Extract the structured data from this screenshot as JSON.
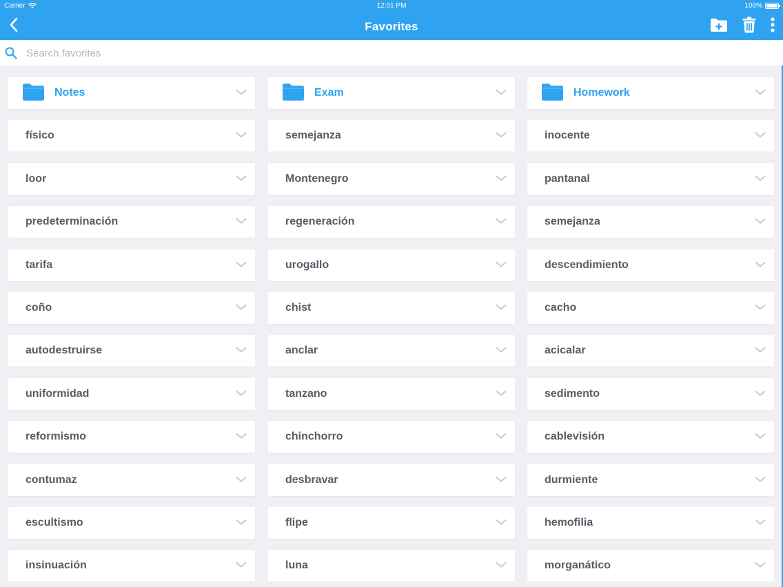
{
  "status_bar": {
    "carrier": "Carrier",
    "time": "12:01 PM",
    "battery": "100%",
    "battery_level": 1.0
  },
  "nav": {
    "title": "Favorites",
    "back_icon": "chevron-left-icon",
    "actions": [
      "add-folder-icon",
      "trash-icon",
      "more-vertical-icon"
    ]
  },
  "search": {
    "placeholder": "Search favorites",
    "value": ""
  },
  "colors": {
    "accent": "#2fa3f0",
    "background": "#efeff4",
    "word_text": "#555e66",
    "chevron": "#c9cfd5"
  },
  "columns": [
    {
      "folder": "Notes",
      "words": [
        "físico",
        "loor",
        "predeterminación",
        "tarifa",
        "coño",
        "autodestruirse",
        "uniformidad",
        "reformismo",
        "contumaz",
        "escultismo",
        "insinuación"
      ]
    },
    {
      "folder": "Exam",
      "words": [
        "semejanza",
        "Montenegro",
        "regeneración",
        "urogallo",
        "chist",
        "anclar",
        "tanzano",
        "chinchorro",
        "desbravar",
        "flipe",
        "luna"
      ]
    },
    {
      "folder": "Homework",
      "words": [
        "inocente",
        "pantanal",
        "semejanza",
        "descendimiento",
        "cacho",
        "acicalar",
        "sedimento",
        "cablevisión",
        "durmiente",
        "hemofilia",
        "morganático"
      ]
    }
  ]
}
